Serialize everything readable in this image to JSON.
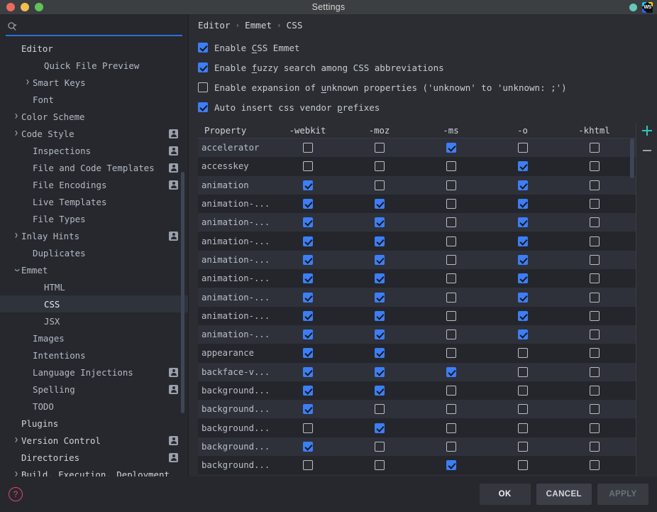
{
  "window": {
    "title": "Settings",
    "traffic_lights": [
      "close",
      "minimize",
      "maximize"
    ],
    "status_dot_color": "#63c9bd",
    "app_icon_label": "WS"
  },
  "search": {
    "value": "",
    "placeholder": "",
    "icon": "search-icon"
  },
  "sidebar": {
    "items": [
      {
        "label": "Editor",
        "indent": 1,
        "arrow": "",
        "bold": true,
        "selected": false,
        "badge": false
      },
      {
        "label": "Quick File Preview",
        "indent": 3,
        "arrow": "",
        "bold": false,
        "selected": false,
        "badge": false
      },
      {
        "label": "Smart Keys",
        "indent": 2,
        "arrow": "›",
        "bold": false,
        "selected": false,
        "badge": false
      },
      {
        "label": "Font",
        "indent": 2,
        "arrow": "",
        "bold": false,
        "selected": false,
        "badge": false
      },
      {
        "label": "Color Scheme",
        "indent": 1,
        "arrow": "›",
        "bold": false,
        "selected": false,
        "badge": false
      },
      {
        "label": "Code Style",
        "indent": 1,
        "arrow": "›",
        "bold": false,
        "selected": false,
        "badge": true
      },
      {
        "label": "Inspections",
        "indent": 2,
        "arrow": "",
        "bold": false,
        "selected": false,
        "badge": true
      },
      {
        "label": "File and Code Templates",
        "indent": 2,
        "arrow": "",
        "bold": false,
        "selected": false,
        "badge": true
      },
      {
        "label": "File Encodings",
        "indent": 2,
        "arrow": "",
        "bold": false,
        "selected": false,
        "badge": true
      },
      {
        "label": "Live Templates",
        "indent": 2,
        "arrow": "",
        "bold": false,
        "selected": false,
        "badge": false
      },
      {
        "label": "File Types",
        "indent": 2,
        "arrow": "",
        "bold": false,
        "selected": false,
        "badge": false
      },
      {
        "label": "Inlay Hints",
        "indent": 1,
        "arrow": "›",
        "bold": false,
        "selected": false,
        "badge": true
      },
      {
        "label": "Duplicates",
        "indent": 2,
        "arrow": "",
        "bold": false,
        "selected": false,
        "badge": false
      },
      {
        "label": "Emmet",
        "indent": 1,
        "arrow": "⌄",
        "bold": false,
        "selected": false,
        "badge": false
      },
      {
        "label": "HTML",
        "indent": 3,
        "arrow": "",
        "bold": false,
        "selected": false,
        "badge": false
      },
      {
        "label": "CSS",
        "indent": 3,
        "arrow": "",
        "bold": false,
        "selected": true,
        "badge": false
      },
      {
        "label": "JSX",
        "indent": 3,
        "arrow": "",
        "bold": false,
        "selected": false,
        "badge": false
      },
      {
        "label": "Images",
        "indent": 2,
        "arrow": "",
        "bold": false,
        "selected": false,
        "badge": false
      },
      {
        "label": "Intentions",
        "indent": 2,
        "arrow": "",
        "bold": false,
        "selected": false,
        "badge": false
      },
      {
        "label": "Language Injections",
        "indent": 2,
        "arrow": "",
        "bold": false,
        "selected": false,
        "badge": true
      },
      {
        "label": "Spelling",
        "indent": 2,
        "arrow": "",
        "bold": false,
        "selected": false,
        "badge": true
      },
      {
        "label": "TODO",
        "indent": 2,
        "arrow": "",
        "bold": false,
        "selected": false,
        "badge": false
      },
      {
        "label": "Plugins",
        "indent": 1,
        "arrow": "",
        "bold": true,
        "selected": false,
        "badge": false
      },
      {
        "label": "Version Control",
        "indent": 1,
        "arrow": "›",
        "bold": true,
        "selected": false,
        "badge": true
      },
      {
        "label": "Directories",
        "indent": 1,
        "arrow": "",
        "bold": true,
        "selected": false,
        "badge": true
      },
      {
        "label": "Build, Execution, Deployment",
        "indent": 1,
        "arrow": "›",
        "bold": true,
        "selected": false,
        "badge": false
      }
    ]
  },
  "main": {
    "breadcrumb": [
      "Editor",
      "Emmet",
      "CSS"
    ],
    "breadcrumb_separator": "›",
    "options": [
      {
        "label_before": "Enable ",
        "underlined": "C",
        "label_after": "SS Emmet",
        "checked": true
      },
      {
        "label_before": "Enable ",
        "underlined": "f",
        "label_after": "uzzy search among CSS abbreviations",
        "checked": true
      },
      {
        "label_before": "Enable expansion of ",
        "underlined": "u",
        "label_after": "nknown properties ('unknown' to 'unknown: ;')",
        "checked": false
      },
      {
        "label_before": "Auto insert css vendor ",
        "underlined": "p",
        "label_after": "refixes",
        "checked": true
      }
    ],
    "table": {
      "columns": [
        "Property",
        "-webkit",
        "-moz",
        "-ms",
        "-o",
        "-khtml"
      ],
      "rows": [
        {
          "property": "accelerator",
          "values": [
            false,
            false,
            true,
            false,
            false
          ]
        },
        {
          "property": "accesskey",
          "values": [
            false,
            false,
            false,
            true,
            false
          ]
        },
        {
          "property": "animation",
          "values": [
            true,
            false,
            false,
            true,
            false
          ]
        },
        {
          "property": "animation-...",
          "values": [
            true,
            true,
            false,
            true,
            false
          ]
        },
        {
          "property": "animation-...",
          "values": [
            true,
            true,
            false,
            true,
            false
          ]
        },
        {
          "property": "animation-...",
          "values": [
            true,
            true,
            false,
            true,
            false
          ]
        },
        {
          "property": "animation-...",
          "values": [
            true,
            true,
            false,
            true,
            false
          ]
        },
        {
          "property": "animation-...",
          "values": [
            true,
            true,
            false,
            true,
            false
          ]
        },
        {
          "property": "animation-...",
          "values": [
            true,
            true,
            false,
            true,
            false
          ]
        },
        {
          "property": "animation-...",
          "values": [
            true,
            true,
            false,
            true,
            false
          ]
        },
        {
          "property": "animation-...",
          "values": [
            true,
            true,
            false,
            true,
            false
          ]
        },
        {
          "property": "appearance",
          "values": [
            true,
            true,
            false,
            false,
            false
          ]
        },
        {
          "property": "backface-v...",
          "values": [
            true,
            true,
            true,
            false,
            false
          ]
        },
        {
          "property": "background...",
          "values": [
            true,
            true,
            false,
            false,
            false
          ]
        },
        {
          "property": "background...",
          "values": [
            true,
            false,
            false,
            false,
            false
          ]
        },
        {
          "property": "background...",
          "values": [
            false,
            true,
            false,
            false,
            false
          ]
        },
        {
          "property": "background...",
          "values": [
            true,
            false,
            false,
            false,
            false
          ]
        },
        {
          "property": "background...",
          "values": [
            false,
            false,
            true,
            false,
            false
          ]
        }
      ]
    },
    "add_button": "+",
    "remove_button": "−"
  },
  "footer": {
    "help_label": "?",
    "ok_label": "OK",
    "cancel_label": "CANCEL",
    "apply_label": "APPLY",
    "apply_disabled": true
  },
  "colors": {
    "accent_blue": "#3c7ef5",
    "teal": "#2fc6bb",
    "help_red": "#e8456b",
    "background": "#2b2d33",
    "sidebar_bg": "#26282e",
    "titlebar_bg": "#3c3f41"
  }
}
